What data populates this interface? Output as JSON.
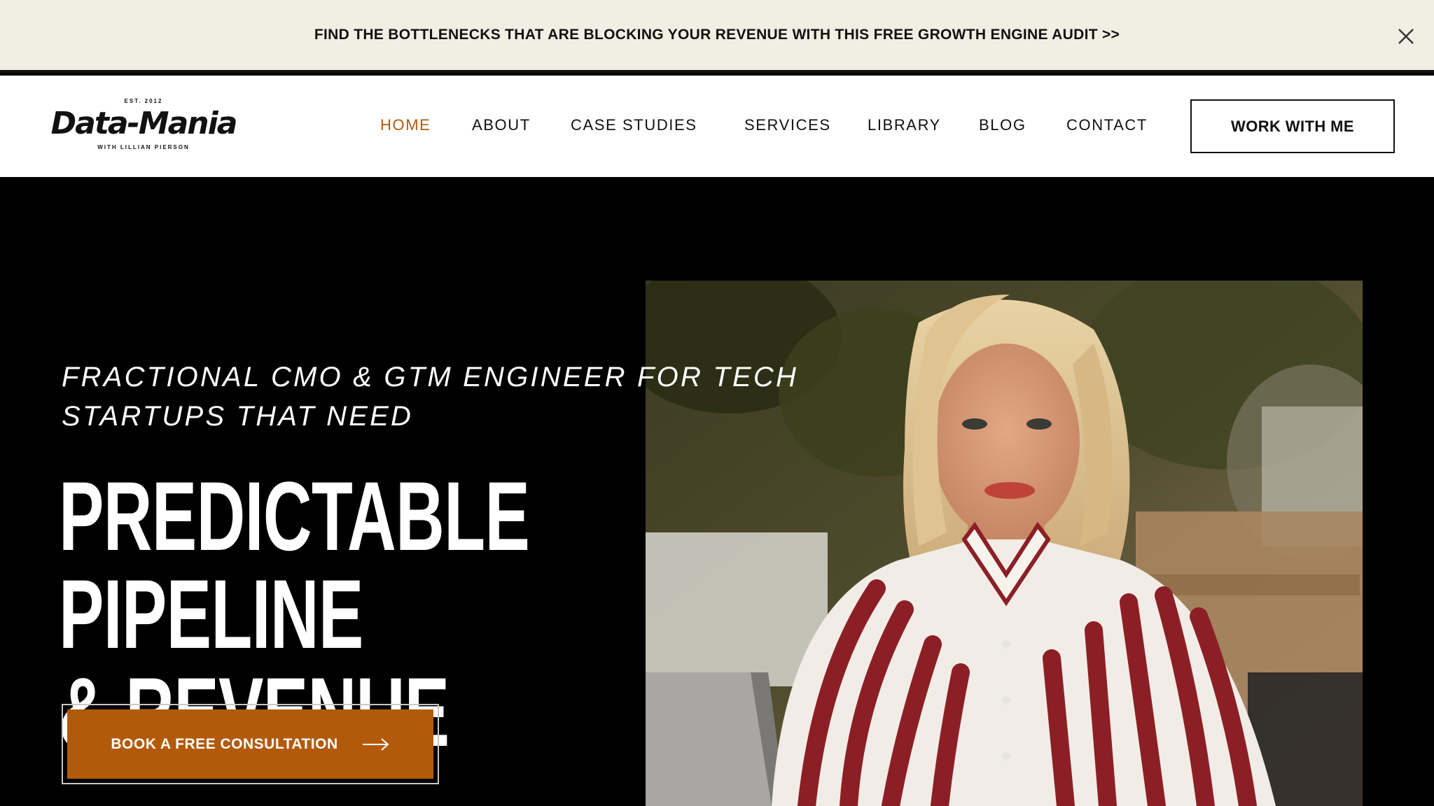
{
  "announcement": {
    "text": "FIND THE BOTTLENECKS THAT ARE BLOCKING YOUR REVENUE WITH THIS FREE GROWTH ENGINE AUDIT >>",
    "close_icon": "close-icon"
  },
  "logo": {
    "est": "EST. 2012",
    "name": "Data-Mania",
    "sub": "WITH LILLIAN PIERSON"
  },
  "nav": {
    "items": [
      {
        "label": "HOME",
        "active": true
      },
      {
        "label": "ABOUT",
        "active": false
      },
      {
        "label": "CASE STUDIES",
        "active": false
      },
      {
        "label": "SERVICES",
        "active": false
      },
      {
        "label": "LIBRARY",
        "active": false
      },
      {
        "label": "BLOG",
        "active": false
      },
      {
        "label": "CONTACT",
        "active": false
      }
    ],
    "cta": "WORK WITH ME"
  },
  "hero": {
    "eyebrow_line1": "FRACTIONAL CMO & GTM ENGINEER FOR TECH",
    "eyebrow_line2": "STARTUPS THAT NEED",
    "headline_line1": "PREDICTABLE PIPELINE",
    "headline_line2": "& REVENUE",
    "cta_label": "BOOK A FREE CONSULTATION",
    "cta_icon": "arrow-right-icon",
    "photo_icon": "portrait-photo"
  },
  "colors": {
    "accent": "#b35a0a",
    "announce_bg": "#f1eee3",
    "hero_bg": "#000000"
  }
}
